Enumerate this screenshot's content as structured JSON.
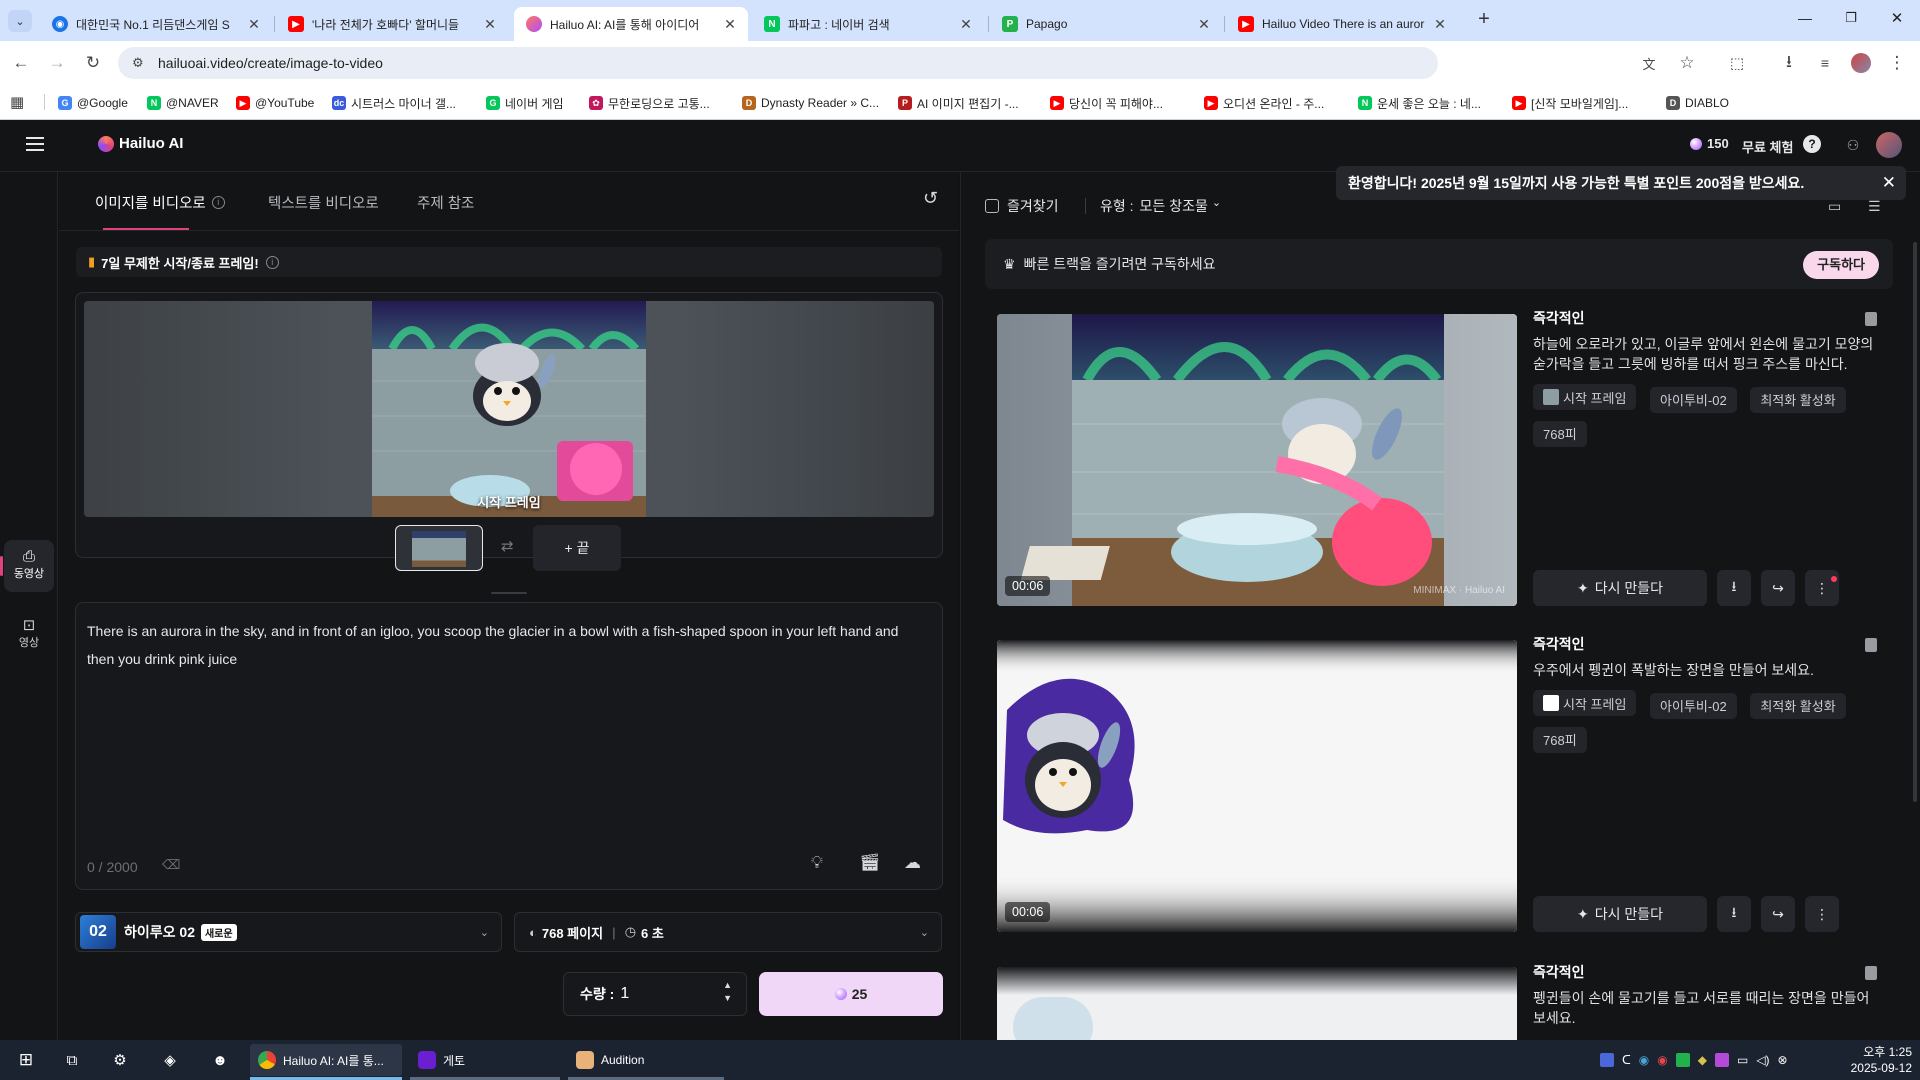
{
  "browser": {
    "tabs": [
      {
        "title": "대한민국 No.1 리듬댄스게임 S",
        "color": "#1a73e8"
      },
      {
        "title": "'나라 전체가 호빠다' 할머니들",
        "color": "#ff0000"
      },
      {
        "title": "Hailuo AI: AI를 통해 아이디어",
        "color": "#e0427f"
      },
      {
        "title": "파파고 : 네이버 검색",
        "color": "#03c75a"
      },
      {
        "title": "Papago",
        "color": "#22b14c"
      },
      {
        "title": "Hailuo Video There is an auror",
        "color": "#ff0000"
      }
    ],
    "new_tab": "+",
    "url": "hailuoai.video/create/image-to-video",
    "bookmarks": [
      {
        "label": "@Google",
        "color": "#4285f4",
        "glyph": "G"
      },
      {
        "label": "@NAVER",
        "color": "#03c75a",
        "glyph": "N"
      },
      {
        "label": "@YouTube",
        "color": "#ff0000",
        "glyph": "▶"
      },
      {
        "label": "시트러스 마이너 갤...",
        "color": "#3b5bdb",
        "glyph": "dc"
      },
      {
        "label": "네이버 게임",
        "color": "#03c75a",
        "glyph": "G"
      },
      {
        "label": "무한로딩으로 고통...",
        "color": "#c2185b",
        "glyph": "✿"
      },
      {
        "label": "Dynasty Reader » C...",
        "color": "#b5651d",
        "glyph": "D"
      },
      {
        "label": "AI 이미지 편집기 -...",
        "color": "#b71c1c",
        "glyph": "P"
      },
      {
        "label": "당신이 꼭 피해야...",
        "color": "#ff0000",
        "glyph": "▶"
      },
      {
        "label": "오디션 온라인 - 주...",
        "color": "#ff0000",
        "glyph": "▶"
      },
      {
        "label": "운세 좋은 오늘 : 네...",
        "color": "#03c75a",
        "glyph": "N"
      },
      {
        "label": "[신작 모바일게임]...",
        "color": "#ff0000",
        "glyph": "▶"
      },
      {
        "label": "DIABLO",
        "color": "#555555",
        "glyph": "D"
      }
    ]
  },
  "app": {
    "logo": "Hailuo AI",
    "credits": "150",
    "free_trial": "무료 체험",
    "help": "?",
    "nav": [
      {
        "label": "동영상",
        "active": true
      },
      {
        "label": "영상",
        "active": false
      }
    ]
  },
  "create": {
    "tabs": [
      "이미지를 비디오로",
      "텍스트를 비디오로",
      "주제 참조"
    ],
    "promo": "7일 무제한 시작/종료 프레임!",
    "frame_label": "시작 프레임",
    "end_button": "+ 끝",
    "prompt": "There is an aurora in the sky, and in front of an igloo, you scoop the glacier in a bowl with a fish-shaped spoon in your left hand and then you drink pink juice",
    "char_count": "0 / 2000",
    "model_name": "하이루오 02",
    "model_badge": "새로운",
    "resolution": "768 페이지",
    "duration": "6 초",
    "quantity_label": "수량 :",
    "quantity": "1",
    "generate_cost": "25"
  },
  "library": {
    "favorites": "즐겨찾기",
    "type_label": "유형 :",
    "type_value": "모든 창조물",
    "toast": "환영합니다! 2025년 9월 15일까지 사용 가능한 특별 포인트 200점을 받으세요.",
    "subscribe_text": "빠른 트랙을 즐기려면 구독하세요",
    "subscribe_button": "구독하다",
    "items": [
      {
        "mode": "즉각적인",
        "prompt": "하늘에 오로라가 있고, 이글루 앞에서 왼손에 물고기 모양의 숟가락을 들고 그릇에 빙하를 떠서 핑크 주스를 마신다.",
        "tags": [
          "시작 프레임",
          "아이투비-02",
          "최적화 활성화",
          "768피"
        ],
        "duration": "00:06",
        "regen": "다시 만들다"
      },
      {
        "mode": "즉각적인",
        "prompt": "우주에서 펭귄이 폭발하는 장면을 만들어 보세요.",
        "tags": [
          "시작 프레임",
          "아이투비-02",
          "최적화 활성화",
          "768피"
        ],
        "duration": "00:06",
        "regen": "다시 만들다"
      },
      {
        "mode": "즉각적인",
        "prompt": "펭귄들이 손에 물고기를 들고 서로를 때리는 장면을 만들어 보세요."
      }
    ]
  },
  "taskbar": {
    "apps": [
      {
        "label": "Hailuo AI: AI를 통...",
        "active": true
      },
      {
        "label": "게토",
        "active": false
      },
      {
        "label": "Audition",
        "active": false
      }
    ],
    "time": "오후 1:25",
    "date": "2025-09-12"
  },
  "colors": {
    "accent": "#e0427f",
    "generate_bg": "#f1d7f7",
    "subscribe_bg": "#f8d8ea"
  }
}
